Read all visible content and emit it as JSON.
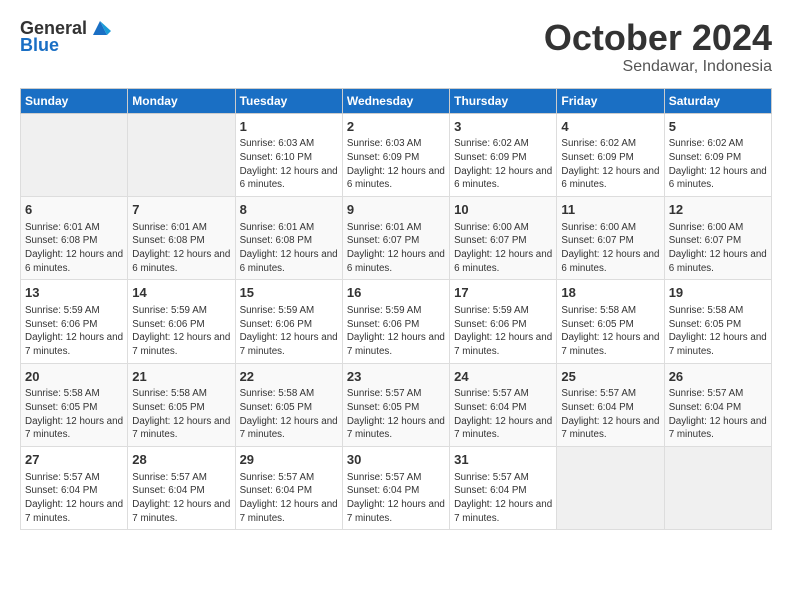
{
  "header": {
    "logo_general": "General",
    "logo_blue": "Blue",
    "month": "October 2024",
    "location": "Sendawar, Indonesia"
  },
  "weekdays": [
    "Sunday",
    "Monday",
    "Tuesday",
    "Wednesday",
    "Thursday",
    "Friday",
    "Saturday"
  ],
  "weeks": [
    [
      {
        "day": "",
        "info": ""
      },
      {
        "day": "",
        "info": ""
      },
      {
        "day": "1",
        "info": "Sunrise: 6:03 AM\nSunset: 6:10 PM\nDaylight: 12 hours and 6 minutes."
      },
      {
        "day": "2",
        "info": "Sunrise: 6:03 AM\nSunset: 6:09 PM\nDaylight: 12 hours and 6 minutes."
      },
      {
        "day": "3",
        "info": "Sunrise: 6:02 AM\nSunset: 6:09 PM\nDaylight: 12 hours and 6 minutes."
      },
      {
        "day": "4",
        "info": "Sunrise: 6:02 AM\nSunset: 6:09 PM\nDaylight: 12 hours and 6 minutes."
      },
      {
        "day": "5",
        "info": "Sunrise: 6:02 AM\nSunset: 6:09 PM\nDaylight: 12 hours and 6 minutes."
      }
    ],
    [
      {
        "day": "6",
        "info": "Sunrise: 6:01 AM\nSunset: 6:08 PM\nDaylight: 12 hours and 6 minutes."
      },
      {
        "day": "7",
        "info": "Sunrise: 6:01 AM\nSunset: 6:08 PM\nDaylight: 12 hours and 6 minutes."
      },
      {
        "day": "8",
        "info": "Sunrise: 6:01 AM\nSunset: 6:08 PM\nDaylight: 12 hours and 6 minutes."
      },
      {
        "day": "9",
        "info": "Sunrise: 6:01 AM\nSunset: 6:07 PM\nDaylight: 12 hours and 6 minutes."
      },
      {
        "day": "10",
        "info": "Sunrise: 6:00 AM\nSunset: 6:07 PM\nDaylight: 12 hours and 6 minutes."
      },
      {
        "day": "11",
        "info": "Sunrise: 6:00 AM\nSunset: 6:07 PM\nDaylight: 12 hours and 6 minutes."
      },
      {
        "day": "12",
        "info": "Sunrise: 6:00 AM\nSunset: 6:07 PM\nDaylight: 12 hours and 6 minutes."
      }
    ],
    [
      {
        "day": "13",
        "info": "Sunrise: 5:59 AM\nSunset: 6:06 PM\nDaylight: 12 hours and 7 minutes."
      },
      {
        "day": "14",
        "info": "Sunrise: 5:59 AM\nSunset: 6:06 PM\nDaylight: 12 hours and 7 minutes."
      },
      {
        "day": "15",
        "info": "Sunrise: 5:59 AM\nSunset: 6:06 PM\nDaylight: 12 hours and 7 minutes."
      },
      {
        "day": "16",
        "info": "Sunrise: 5:59 AM\nSunset: 6:06 PM\nDaylight: 12 hours and 7 minutes."
      },
      {
        "day": "17",
        "info": "Sunrise: 5:59 AM\nSunset: 6:06 PM\nDaylight: 12 hours and 7 minutes."
      },
      {
        "day": "18",
        "info": "Sunrise: 5:58 AM\nSunset: 6:05 PM\nDaylight: 12 hours and 7 minutes."
      },
      {
        "day": "19",
        "info": "Sunrise: 5:58 AM\nSunset: 6:05 PM\nDaylight: 12 hours and 7 minutes."
      }
    ],
    [
      {
        "day": "20",
        "info": "Sunrise: 5:58 AM\nSunset: 6:05 PM\nDaylight: 12 hours and 7 minutes."
      },
      {
        "day": "21",
        "info": "Sunrise: 5:58 AM\nSunset: 6:05 PM\nDaylight: 12 hours and 7 minutes."
      },
      {
        "day": "22",
        "info": "Sunrise: 5:58 AM\nSunset: 6:05 PM\nDaylight: 12 hours and 7 minutes."
      },
      {
        "day": "23",
        "info": "Sunrise: 5:57 AM\nSunset: 6:05 PM\nDaylight: 12 hours and 7 minutes."
      },
      {
        "day": "24",
        "info": "Sunrise: 5:57 AM\nSunset: 6:04 PM\nDaylight: 12 hours and 7 minutes."
      },
      {
        "day": "25",
        "info": "Sunrise: 5:57 AM\nSunset: 6:04 PM\nDaylight: 12 hours and 7 minutes."
      },
      {
        "day": "26",
        "info": "Sunrise: 5:57 AM\nSunset: 6:04 PM\nDaylight: 12 hours and 7 minutes."
      }
    ],
    [
      {
        "day": "27",
        "info": "Sunrise: 5:57 AM\nSunset: 6:04 PM\nDaylight: 12 hours and 7 minutes."
      },
      {
        "day": "28",
        "info": "Sunrise: 5:57 AM\nSunset: 6:04 PM\nDaylight: 12 hours and 7 minutes."
      },
      {
        "day": "29",
        "info": "Sunrise: 5:57 AM\nSunset: 6:04 PM\nDaylight: 12 hours and 7 minutes."
      },
      {
        "day": "30",
        "info": "Sunrise: 5:57 AM\nSunset: 6:04 PM\nDaylight: 12 hours and 7 minutes."
      },
      {
        "day": "31",
        "info": "Sunrise: 5:57 AM\nSunset: 6:04 PM\nDaylight: 12 hours and 7 minutes."
      },
      {
        "day": "",
        "info": ""
      },
      {
        "day": "",
        "info": ""
      }
    ]
  ]
}
